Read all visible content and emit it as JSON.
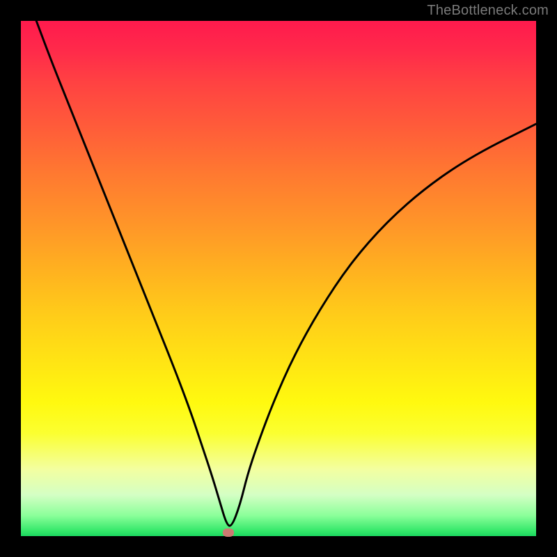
{
  "watermark": "TheBottleneck.com",
  "marker": {
    "x_pct": 40.3,
    "y_pct": 99.3
  },
  "chart_data": {
    "type": "line",
    "title": "",
    "xlabel": "",
    "ylabel": "",
    "xlim": [
      0,
      100
    ],
    "ylim": [
      0,
      100
    ],
    "series": [
      {
        "name": "bottleneck-curve",
        "x": [
          3,
          6,
          10,
          14,
          18,
          22,
          26,
          30,
          33,
          35,
          37,
          38.5,
          40,
          41,
          42.5,
          44,
          46,
          49,
          53,
          58,
          64,
          71,
          79,
          88,
          100
        ],
        "y": [
          100,
          92,
          82,
          72,
          62,
          52,
          42,
          32,
          24,
          18,
          12,
          7,
          2,
          2,
          6,
          12,
          18,
          26,
          35,
          44,
          53,
          61,
          68,
          74,
          80
        ]
      }
    ],
    "annotations": [
      {
        "type": "marker",
        "x": 40.3,
        "y": 0.7,
        "label": "optimal-point"
      }
    ],
    "background_gradient": {
      "top": "#ff1a4d",
      "mid": "#ffe414",
      "bottom": "#1bd75f"
    }
  }
}
